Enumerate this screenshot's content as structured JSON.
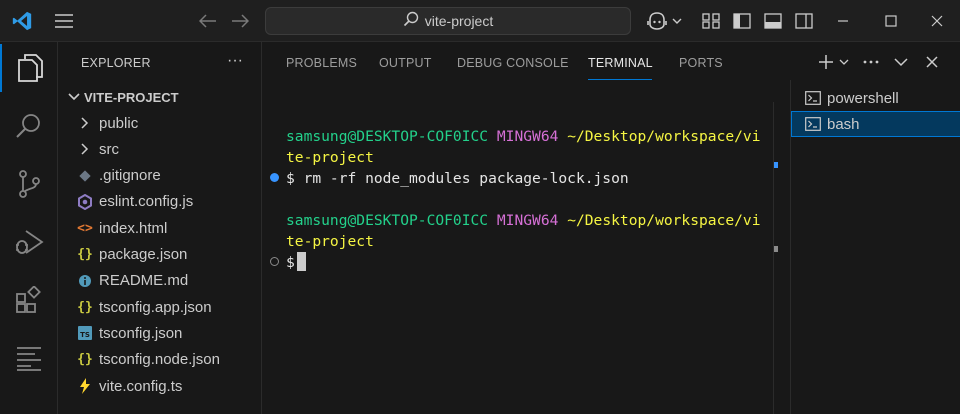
{
  "titlebar": {
    "search_text": "vite-project"
  },
  "explorer": {
    "title": "EXPLORER",
    "more_label": "···",
    "root_folder": "VITE-PROJECT",
    "items": [
      {
        "label": "public",
        "kind": "folder",
        "icon": "chevron-right-icon"
      },
      {
        "label": "src",
        "kind": "folder",
        "icon": "chevron-right-icon"
      },
      {
        "label": ".gitignore",
        "kind": "file",
        "icon": "git-diamond-icon",
        "color": "#6b7785"
      },
      {
        "label": "eslint.config.js",
        "kind": "file",
        "icon": "eslint-icon",
        "color": "#8e7cc3"
      },
      {
        "label": "index.html",
        "kind": "file",
        "icon": "html-icon",
        "color": "#e37933",
        "glyph": "<>"
      },
      {
        "label": "package.json",
        "kind": "file",
        "icon": "json-icon",
        "color": "#cbcb41",
        "glyph": "{}"
      },
      {
        "label": "README.md",
        "kind": "file",
        "icon": "info-icon",
        "color": "#519aba"
      },
      {
        "label": "tsconfig.app.json",
        "kind": "file",
        "icon": "json-icon",
        "color": "#cbcb41",
        "glyph": "{}"
      },
      {
        "label": "tsconfig.json",
        "kind": "file",
        "icon": "typescript-icon",
        "color": "#519aba",
        "glyph": "TS"
      },
      {
        "label": "tsconfig.node.json",
        "kind": "file",
        "icon": "json-icon",
        "color": "#cbcb41",
        "glyph": "{}"
      },
      {
        "label": "vite.config.ts",
        "kind": "file",
        "icon": "vite-icon",
        "color": "#ffd62e"
      }
    ]
  },
  "panel": {
    "tabs": [
      {
        "label": "PROBLEMS",
        "active": false
      },
      {
        "label": "OUTPUT",
        "active": false
      },
      {
        "label": "DEBUG CONSOLE",
        "active": false
      },
      {
        "label": "TERMINAL",
        "active": true
      },
      {
        "label": "PORTS",
        "active": false
      }
    ],
    "actions": [
      "add-terminal-icon",
      "chevron-down-icon",
      "more-icon",
      "chevron-down-icon",
      "close-icon"
    ]
  },
  "terminal": {
    "lines": {
      "prompt1_user": "samsung@DESKTOP-COF0ICC",
      "prompt1_env": "MINGW64",
      "prompt1_path_a": "~/Desktop/workspace/vi",
      "prompt1_path_b": "te-project",
      "command": "$ rm -rf node_modules package-lock.json",
      "prompt2_user": "samsung@DESKTOP-COF0ICC",
      "prompt2_env": "MINGW64",
      "prompt2_path_a": "~/Desktop/workspace/vi",
      "prompt2_path_b": "te-project",
      "prompt3": "$"
    },
    "sessions": [
      {
        "label": "powershell",
        "selected": false
      },
      {
        "label": "bash",
        "selected": true
      }
    ]
  },
  "colors": {
    "accent": "#0078d4",
    "prompt_user": "#23d18b",
    "prompt_env": "#d670d6",
    "prompt_path": "#f5f543"
  }
}
